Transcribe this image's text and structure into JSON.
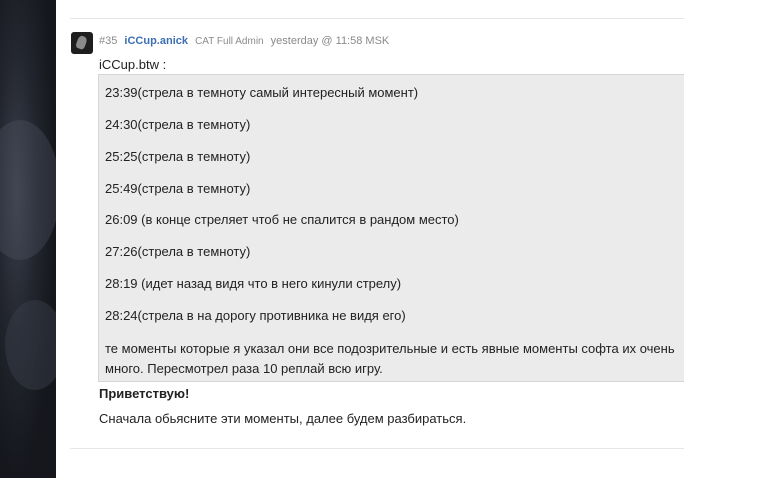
{
  "post": {
    "number": "#35",
    "author": "iCCup.anick",
    "role": "CAT Full Admin",
    "time": "yesterday @ 11:58 MSK"
  },
  "quote": {
    "author": "iCCup.btw :",
    "lines": [
      "23:39(стрела в темноту самый интересный момент)",
      "24:30(стрела в темноту)",
      "25:25(стрела в темноту)",
      "25:49(стрела в темноту)",
      "26:09 (в конце стреляет чтоб не спалится в рандом место)",
      "27:26(стрела в темноту)",
      "28:19 (идет назад видя что в него кинули стрелу)",
      "28:24(стрела в на дорогу противника не видя его)"
    ],
    "closing": "те моменты которые я указал они все подозрительные и есть явные моменты софта их очень много. Пересмотрел раза 10 реплай всю игру."
  },
  "reply": {
    "greeting": "Приветствую!",
    "text": "Сначала обьясните эти моменты, далее будем разбираться."
  }
}
